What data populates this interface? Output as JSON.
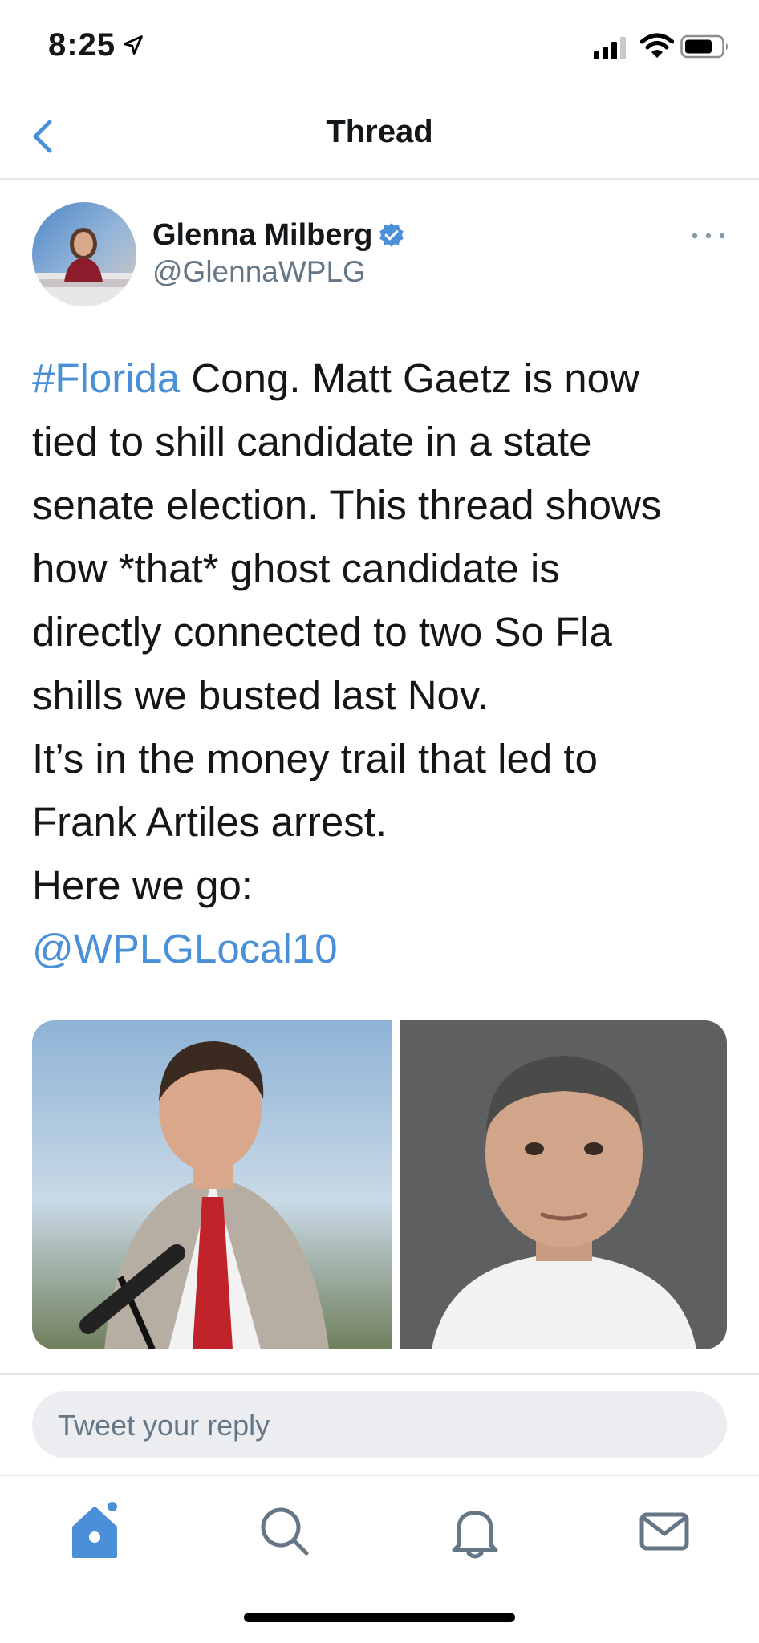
{
  "status_bar": {
    "time": "8:25"
  },
  "nav": {
    "title": "Thread"
  },
  "tweet": {
    "author_name": "Glenna Milberg",
    "author_handle": "@GlennaWPLG",
    "lines": [
      {
        "link": "#Florida",
        "text": " Cong. Matt Gaetz is now"
      },
      {
        "text": "tied to shill candidate in a state"
      },
      {
        "text": "senate election. This thread shows"
      },
      {
        "text": "how *that* ghost candidate is"
      },
      {
        "text": "directly connected to two So Fla"
      },
      {
        "text": "shills we busted last Nov."
      },
      {
        "text": "It’s in the money trail that led to"
      },
      {
        "text": "Frank Artiles arrest."
      },
      {
        "text": "Here we go:"
      },
      {
        "link": "@WPLGLocal10"
      }
    ]
  },
  "reply": {
    "placeholder": "Tweet your reply"
  },
  "tabs": [
    "home-icon",
    "search-icon",
    "notifications-icon",
    "messages-icon"
  ],
  "colors": {
    "accent": "#4a90d9",
    "text": "#14171a",
    "secondary": "#657786"
  }
}
